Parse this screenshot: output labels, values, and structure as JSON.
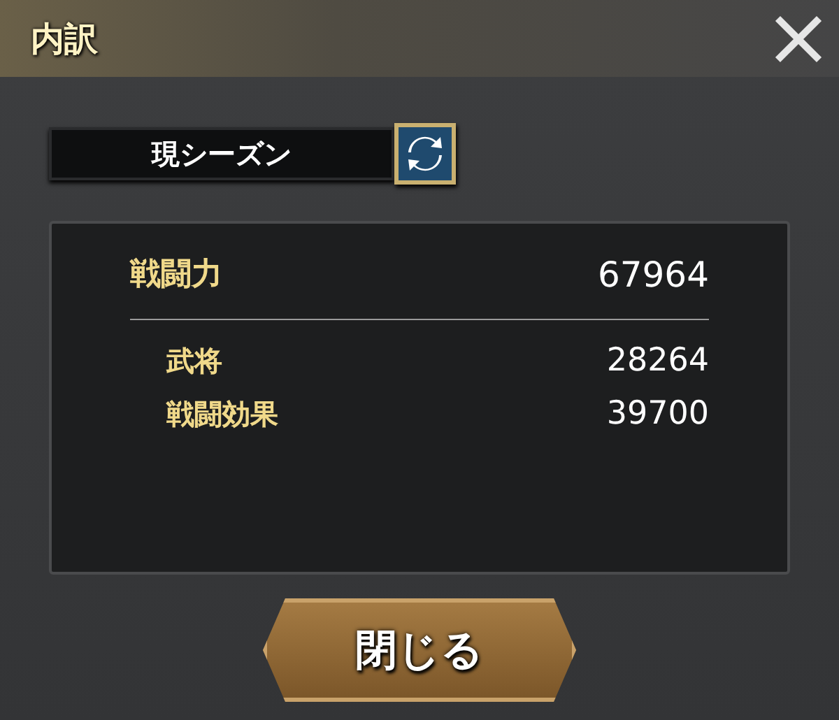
{
  "window": {
    "title": "内訳"
  },
  "season_select": {
    "value": "現シーズン"
  },
  "breakdown": {
    "total": {
      "label": "戦闘力",
      "value": "67964"
    },
    "items": [
      {
        "label": "武将",
        "value": "28264"
      },
      {
        "label": "戦闘効果",
        "value": "39700"
      }
    ]
  },
  "buttons": [
    "閉じる"
  ]
}
